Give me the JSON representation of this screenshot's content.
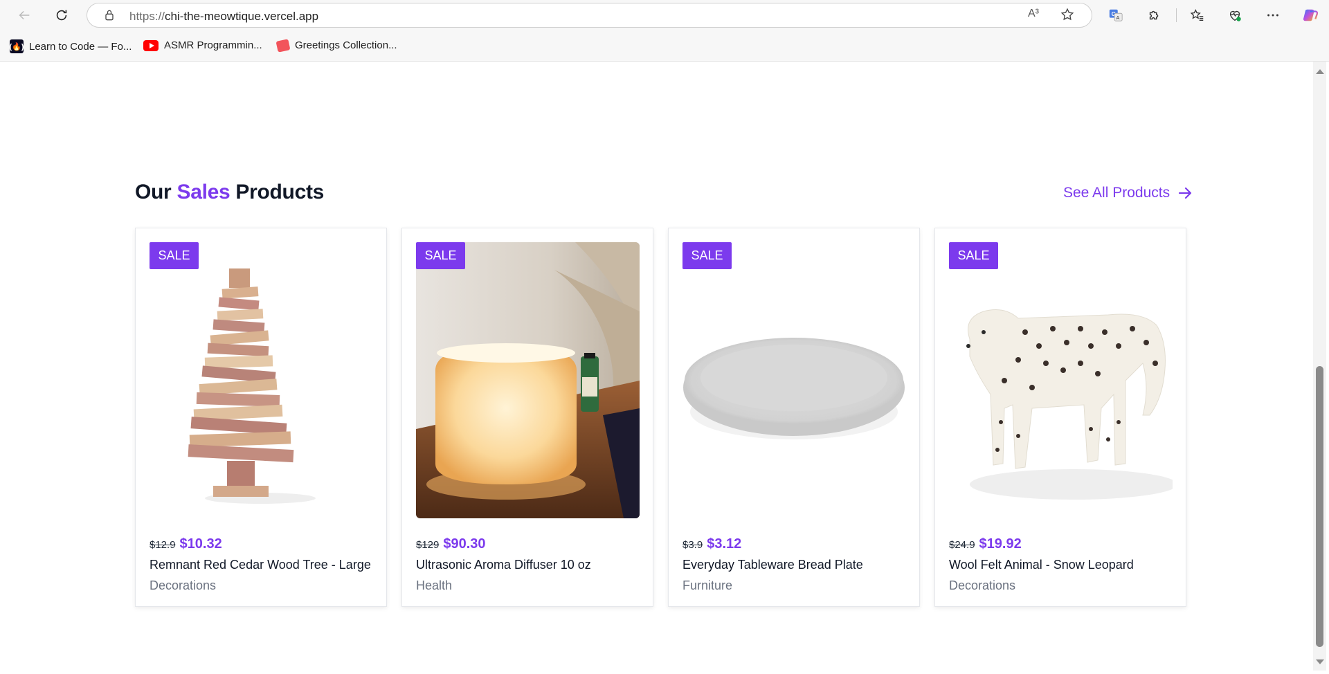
{
  "browser": {
    "url_scheme": "https://",
    "url_host": "chi-the-meowtique.vercel.app",
    "read_aloud": "A³",
    "bookmarks": [
      {
        "label": "Learn to Code — Fo..."
      },
      {
        "label": "ASMR Programmin..."
      },
      {
        "label": "Greetings Collection..."
      }
    ],
    "icons": {
      "back": "back-arrow-icon",
      "reload": "reload-icon",
      "lock": "lock-icon",
      "favorite": "star-icon",
      "translate": "translate-icon",
      "extensions": "puzzle-icon",
      "favorites": "favorites-icon",
      "health": "browser-essentials-icon",
      "more": "more-icon",
      "copilot": "copilot-icon"
    }
  },
  "section": {
    "title_prefix": "Our ",
    "title_accent": "Sales",
    "title_suffix": " Products",
    "see_all": "See All Products"
  },
  "products": [
    {
      "badge": "SALE",
      "old_price": "$12.9",
      "new_price": "$10.32",
      "name": "Remnant Red Cedar Wood Tree - Large",
      "category": "Decorations"
    },
    {
      "badge": "SALE",
      "old_price": "$129",
      "new_price": "$90.30",
      "name": "Ultrasonic Aroma Diffuser 10 oz",
      "category": "Health"
    },
    {
      "badge": "SALE",
      "old_price": "$3.9",
      "new_price": "$3.12",
      "name": "Everyday Tableware Bread Plate",
      "category": "Furniture"
    },
    {
      "badge": "SALE",
      "old_price": "$24.9",
      "new_price": "$19.92",
      "name": "Wool Felt Animal - Snow Leopard",
      "category": "Decorations"
    }
  ],
  "colors": {
    "accent": "#7c3aed",
    "heading": "#111827",
    "muted": "#6b7280"
  }
}
